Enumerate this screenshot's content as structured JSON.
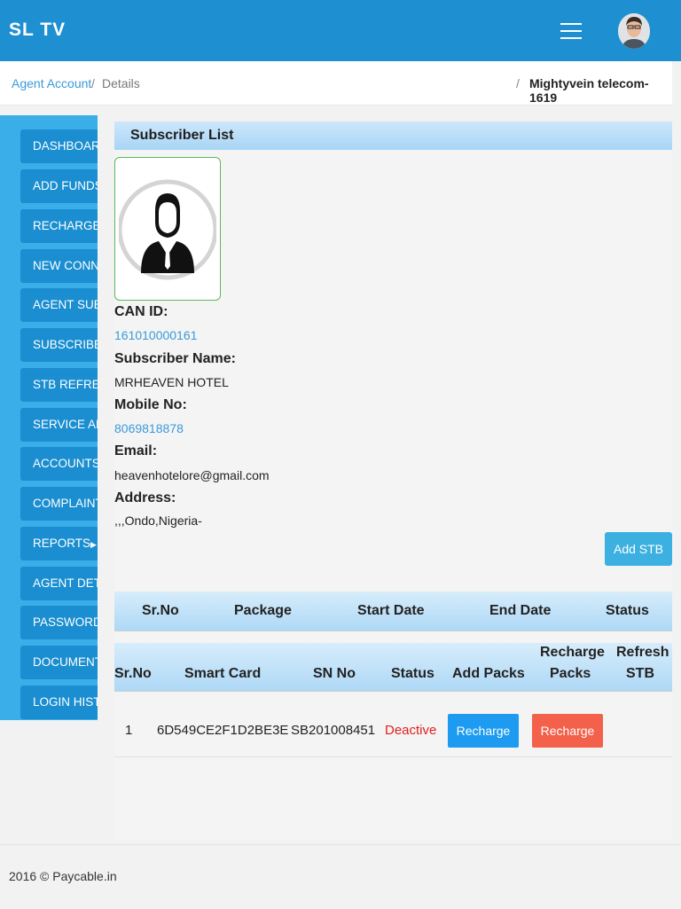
{
  "header": {
    "brand": "SL TV"
  },
  "breadcrumb": {
    "link": "Agent Account",
    "separator": "/",
    "current": "Details",
    "right": "Mightyvein telecom-1619"
  },
  "sidebar": {
    "items": [
      {
        "label": "DASHBOARD"
      },
      {
        "label": "ADD FUNDS"
      },
      {
        "label": "RECHARGE"
      },
      {
        "label": "NEW CONNE"
      },
      {
        "label": "AGENT SUB"
      },
      {
        "label": "SUBSCRIBER"
      },
      {
        "label": "STB REFRESH"
      },
      {
        "label": "SERVICE ALE"
      },
      {
        "label": "ACCOUNTS",
        "caret": "▶"
      },
      {
        "label": "COMPLAINT"
      },
      {
        "label": "REPORTS",
        "caret": "▶"
      },
      {
        "label": "AGENT DETA"
      },
      {
        "label": "PASSWORD"
      },
      {
        "label": "DOCUMENTS"
      },
      {
        "label": "LOGIN HISTO"
      }
    ]
  },
  "panel": {
    "title": "Subscriber List"
  },
  "subscriber": {
    "can_id_label": "CAN ID:",
    "can_id": "161010000161",
    "name_label": "Subscriber Name:",
    "name": "MRHEAVEN HOTEL",
    "mobile_label": "Mobile No:",
    "mobile": "8069818878",
    "email_label": "Email:",
    "email": "heavenhotelore@gmail.com",
    "address_label": "Address:",
    "address": ",,,Ondo,Nigeria-"
  },
  "add_stb_label": "Add STB",
  "package_table": {
    "headers": [
      "Sr.No",
      "Package",
      "Start Date",
      "End Date",
      "Status"
    ]
  },
  "stb_table": {
    "headers": {
      "srno": "Sr.No",
      "smart_card": "Smart Card",
      "sn_no": "SN No",
      "status": "Status",
      "add_packs": "Add Packs",
      "recharge_packs_1": "Recharge",
      "recharge_packs_2": "Packs",
      "refresh_stb_1": "Refresh",
      "refresh_stb_2": "STB"
    },
    "rows": [
      {
        "srno": "1",
        "smart_card": "6D549CE2F1D2BE3E",
        "sn_no": "SB201008451",
        "status": "Deactive",
        "add_packs_button": "Recharge",
        "recharge_packs_button": "Recharge"
      }
    ]
  },
  "colors": {
    "header_blue": "#1e8fd0",
    "status_deactive": "#e02020",
    "btn_blue": "#1c9bf0",
    "btn_red": "#f4614a"
  },
  "footer": {
    "text": "2016 © Paycable.in"
  }
}
